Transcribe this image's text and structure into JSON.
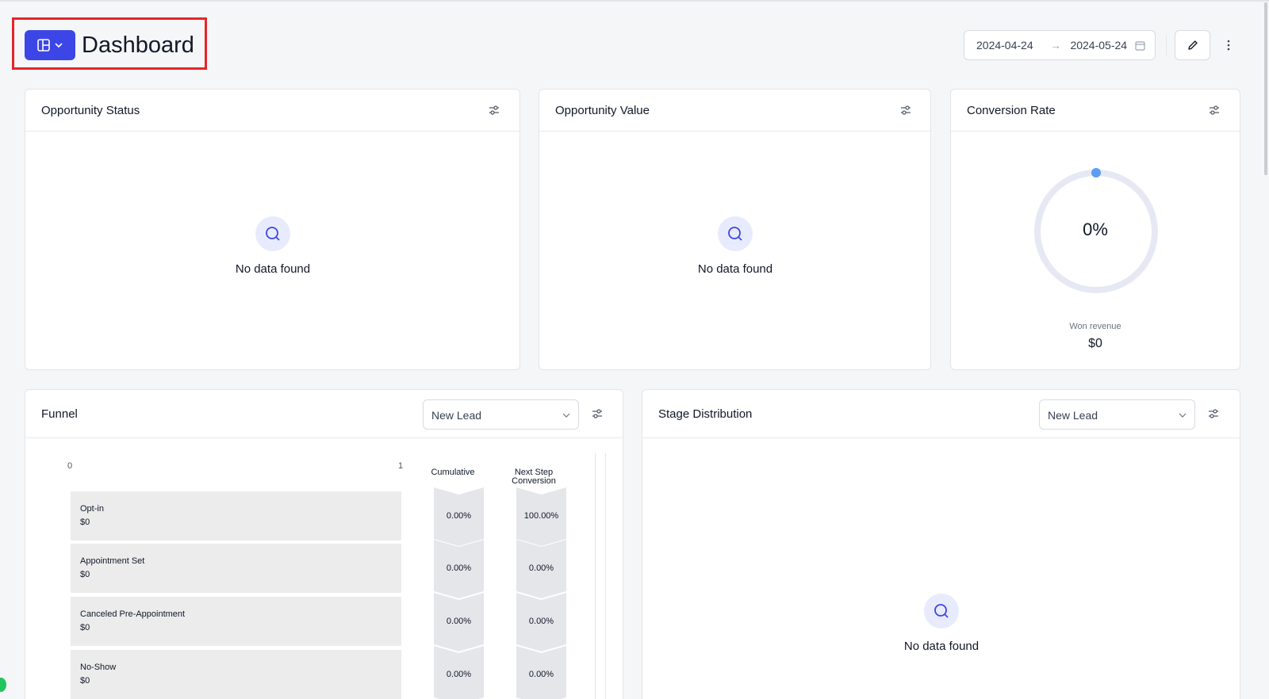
{
  "header": {
    "title": "Dashboard",
    "date_start": "2024-04-24",
    "date_end": "2024-05-24"
  },
  "cards": {
    "opportunity_status": {
      "title": "Opportunity Status",
      "empty_text": "No data found"
    },
    "opportunity_value": {
      "title": "Opportunity Value",
      "empty_text": "No data found"
    },
    "conversion_rate": {
      "title": "Conversion Rate",
      "rate": "0%",
      "won_label": "Won revenue",
      "won_value": "$0"
    },
    "funnel": {
      "title": "Funnel",
      "select_value": "New Lead",
      "axis_min": "0",
      "axis_max": "1",
      "col_cumulative": "Cumulative",
      "col_next_line1": "Next Step",
      "col_next_line2": "Conversion",
      "stages": [
        {
          "name": "Opt-in",
          "value": "$0",
          "cumulative": "0.00%",
          "next": "100.00%"
        },
        {
          "name": "Appointment Set",
          "value": "$0",
          "cumulative": "0.00%",
          "next": "0.00%"
        },
        {
          "name": "Canceled Pre-Appointment",
          "value": "$0",
          "cumulative": "0.00%",
          "next": "0.00%"
        },
        {
          "name": "No-Show",
          "value": "$0",
          "cumulative": "0.00%",
          "next": "0.00%"
        }
      ]
    },
    "stage_distribution": {
      "title": "Stage Distribution",
      "select_value": "New Lead",
      "empty_text": "No data found"
    }
  },
  "colors": {
    "accent": "#3c46e6",
    "highlight_border": "#e5252a",
    "donut_track": "#e6e9f4",
    "donut_dot": "#5b9cf4"
  },
  "icons": {
    "dashboard_switch": "layout-icon",
    "date": "calendar-icon",
    "edit": "pencil-icon",
    "more": "more-vertical-icon",
    "filter": "sliders-icon",
    "empty": "search-icon"
  }
}
